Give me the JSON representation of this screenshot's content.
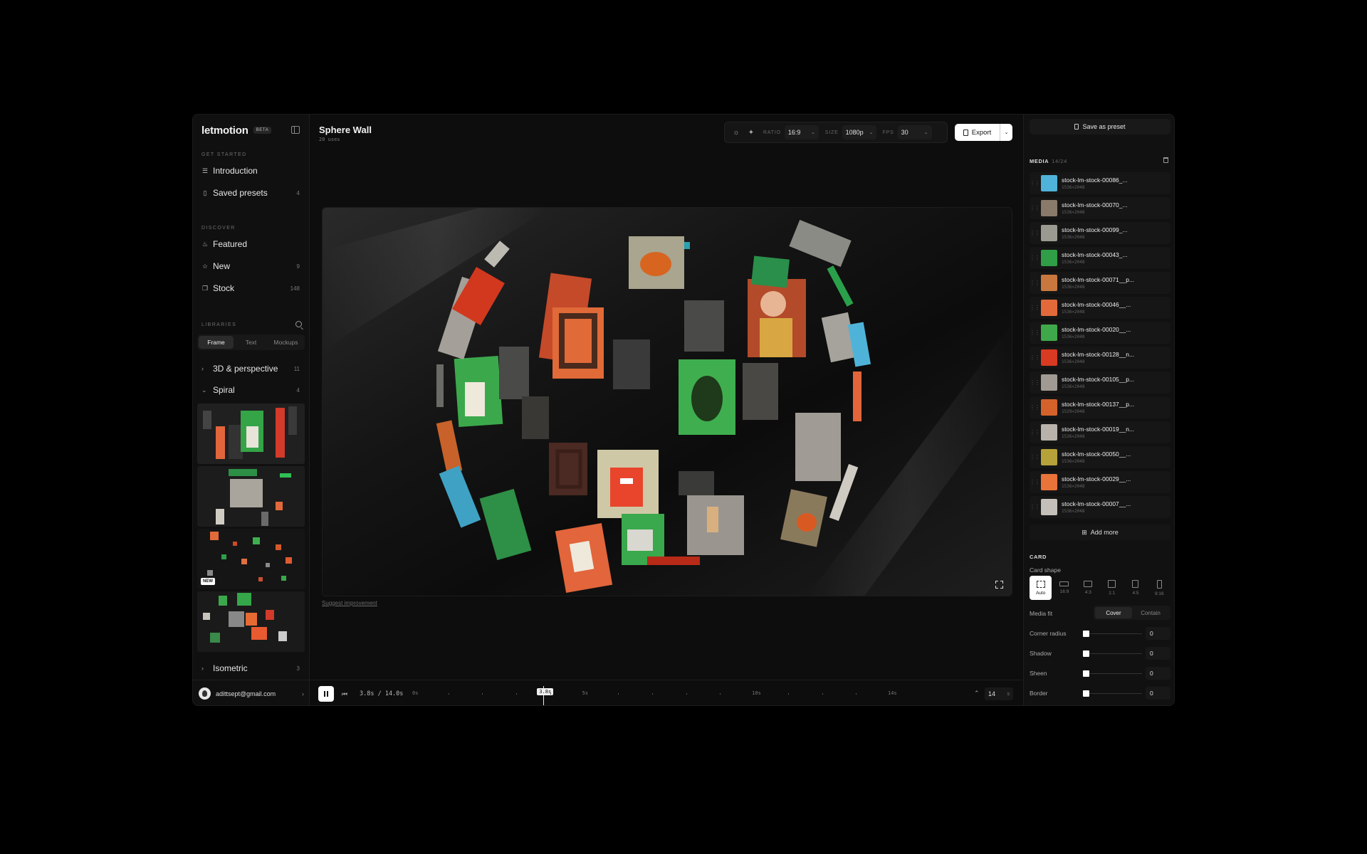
{
  "app": {
    "logo": "letmotion",
    "beta": "BETA"
  },
  "sidebar": {
    "get_started_label": "GET STARTED",
    "get_started": [
      {
        "label": "Introduction",
        "icon": "list-icon",
        "count": ""
      },
      {
        "label": "Saved presets",
        "icon": "bookmark-icon",
        "count": "4"
      }
    ],
    "discover_label": "DISCOVER",
    "discover": [
      {
        "label": "Featured",
        "icon": "flame-icon",
        "count": ""
      },
      {
        "label": "New",
        "icon": "star-icon",
        "count": "9"
      },
      {
        "label": "Stock",
        "icon": "stack-icon",
        "count": "148"
      }
    ],
    "libraries_label": "LIBRARIES",
    "library_tabs": [
      "Frame",
      "Text",
      "Mockups"
    ],
    "library_active_tab": "Frame",
    "groups": [
      {
        "label": "3D & perspective",
        "count": "11",
        "expanded": false
      },
      {
        "label": "Spiral",
        "count": "4",
        "expanded": true
      },
      {
        "label": "Isometric",
        "count": "3",
        "expanded": false
      }
    ],
    "new_badge": "NEW",
    "account_email": "adittsept@gmail.com"
  },
  "project": {
    "title": "Sphere Wall",
    "uses": "20 uses"
  },
  "toolbar": {
    "ratio_label": "RATIO",
    "ratio_value": "16:9",
    "size_label": "SIZE",
    "size_value": "1080p",
    "fps_label": "FPS",
    "fps_value": "30",
    "export_label": "Export"
  },
  "stage": {
    "suggest_link": "Suggest improvement"
  },
  "timeline": {
    "timecode": "3.8s / 14.0s",
    "labels": [
      "0s",
      "5s",
      "10s",
      "14s"
    ],
    "playhead_label": "3.8s",
    "current_seconds": 3.8,
    "duration_seconds": 14.0,
    "duration_value": "14",
    "duration_unit": "s"
  },
  "panel": {
    "save_preset": "Save as preset",
    "media_label": "MEDIA",
    "media_count": "14/24",
    "media": [
      {
        "name": "stock-lm-stock-00086_...",
        "dim": "1536×2048",
        "color": "#4fb3d9"
      },
      {
        "name": "stock-lm-stock-00070_...",
        "dim": "1536×2048",
        "color": "#8a7a6a"
      },
      {
        "name": "stock-lm-stock-00099_...",
        "dim": "1536×2048",
        "color": "#9a9a90"
      },
      {
        "name": "stock-lm-stock-00043_...",
        "dim": "1536×2048",
        "color": "#2f9e46"
      },
      {
        "name": "stock-lm-stock-00071__p...",
        "dim": "1536×2048",
        "color": "#c8783e"
      },
      {
        "name": "stock-lm-stock-00046__...",
        "dim": "1536×2048",
        "color": "#e26a3a"
      },
      {
        "name": "stock-lm-stock-00020__...",
        "dim": "1536×2048",
        "color": "#3fa84a"
      },
      {
        "name": "stock-lm-stock-00128__n...",
        "dim": "1536×2048",
        "color": "#d83a22"
      },
      {
        "name": "stock-lm-stock-00105__p...",
        "dim": "1536×2048",
        "color": "#a09a92"
      },
      {
        "name": "stock-lm-stock-00137__p...",
        "dim": "1529×2048",
        "color": "#d4622a"
      },
      {
        "name": "stock-lm-stock-00019__n...",
        "dim": "1536×2048",
        "color": "#b8b2aa"
      },
      {
        "name": "stock-lm-stock-00050__...",
        "dim": "1536×2048",
        "color": "#b7a23a"
      },
      {
        "name": "stock-lm-stock-00029__...",
        "dim": "1536×2048",
        "color": "#e8743a"
      },
      {
        "name": "stock-lm-stock-00007__...",
        "dim": "1536×2048",
        "color": "#c4bfb8"
      }
    ],
    "add_more": "Add more",
    "card_label": "CARD",
    "card_shape_label": "Card shape",
    "shapes": [
      "Auto",
      "16:9",
      "4:3",
      "1:1",
      "4:5",
      "9:16"
    ],
    "active_shape": "Auto",
    "media_fit_label": "Media fit",
    "fit_options": [
      "Cover",
      "Contain"
    ],
    "active_fit": "Cover",
    "sliders": [
      {
        "label": "Corner radius",
        "value": "0"
      },
      {
        "label": "Shadow",
        "value": "0"
      },
      {
        "label": "Sheen",
        "value": "0"
      },
      {
        "label": "Border",
        "value": "0"
      }
    ]
  },
  "colors": {
    "accent_white": "#ffffff",
    "bg": "#0d0d0d",
    "panel": "#111111"
  }
}
